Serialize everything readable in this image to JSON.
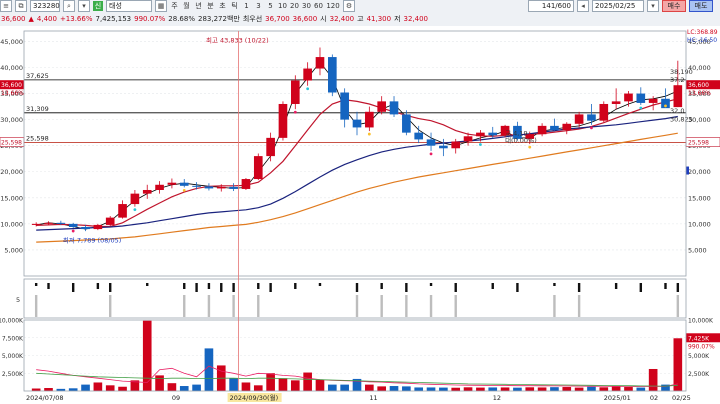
{
  "toolbar": {
    "code": "323280",
    "market_badge": "신",
    "name": "태성",
    "price": "36,600",
    "change": "4,400",
    "change_pct": "+13.66%",
    "volume": "7,425,153",
    "turnover_pct": "990.07%",
    "ratio": "28.68%",
    "trade_value": "283,272백만",
    "priority_label": "최우선",
    "bid": "36,700",
    "ask": "36,600",
    "open_label": "시",
    "open": "32,400",
    "high_label": "고",
    "high": "41,300",
    "low_label": "저",
    "low": "32,400",
    "periods": [
      "주",
      "월",
      "년",
      "분",
      "초",
      "틱"
    ],
    "minutes": [
      "1",
      "3",
      "5",
      "10",
      "20",
      "30",
      "60",
      "120"
    ],
    "count": "141/600",
    "date": "2025/02/25",
    "buy_label": "매수",
    "sell_label": "매도"
  },
  "chart_data": [
    {
      "type": "candlestick",
      "title": "",
      "y_ticks": [
        "45,000",
        "40,000",
        "35,000",
        "30,000",
        "25,000",
        "20,000",
        "15,000",
        "10,000",
        "5,000"
      ],
      "ylim": [
        0,
        47000
      ],
      "x_labels": [
        "2024/07/08",
        "09",
        "2024/09/30(월)",
        "11",
        "12",
        "2025/01",
        "02",
        "02/25"
      ],
      "hlines": [
        {
          "label": "37,625",
          "value": 37625,
          "color": "#000000"
        },
        {
          "label": "31,309",
          "value": 31309,
          "color": "#000000"
        },
        {
          "label": "25,598",
          "value": 25598,
          "color": "#c0392b"
        }
      ],
      "annotations": [
        {
          "text": "최고 43,833 (10/22)",
          "value": 43833
        },
        {
          "text": "최저 7,789 (08/05)",
          "value": 7789
        },
        {
          "text": "38,190",
          "value": 38190
        },
        {
          "text": "37.2",
          "value": 37200
        },
        {
          "text": "32.0",
          "value": 32000
        },
        {
          "text": "30,825",
          "value": 30825
        },
        {
          "text": "교 4,19",
          "value": 27000
        },
        {
          "text": "대(0.00%)",
          "value": 25600
        }
      ],
      "right_labels": {
        "lc": "LC:368.89",
        "hc": "HC:-16.50",
        "price": "36,600",
        "pct": "13.66%"
      },
      "left_labels": {
        "price": "36,600",
        "pct": "13.66%",
        "level": "25,598"
      },
      "series": [
        {
          "name": "ma5",
          "color": "#000000",
          "values": [
            9800,
            10200,
            10000,
            9500,
            9000,
            9500,
            10500,
            12500,
            14500,
            15800,
            16800,
            17500,
            17800,
            17500,
            17200,
            17000,
            16800,
            17000,
            20000,
            23000,
            28500,
            35000,
            38000,
            41000,
            38000,
            32000,
            29000,
            29500,
            32000,
            33000,
            30500,
            28000,
            26500,
            25500,
            25000,
            25800,
            26500,
            27000,
            27800,
            26500,
            26500,
            27800,
            28200,
            28500,
            28800,
            29500,
            30500,
            32000,
            33000,
            33800,
            34000,
            34500,
            35500
          ]
        },
        {
          "name": "ma20",
          "color": "#c0152d",
          "values": [
            9700,
            9800,
            9900,
            9850,
            9700,
            9500,
            9500,
            10200,
            11500,
            12800,
            14000,
            15200,
            16100,
            16800,
            17200,
            17300,
            17300,
            17400,
            18000,
            19800,
            22000,
            25000,
            28000,
            31000,
            33000,
            33800,
            33500,
            33000,
            32200,
            31500,
            30800,
            30200,
            29800,
            29000,
            27900,
            27200,
            26900,
            26800,
            27000,
            27100,
            27200,
            27300,
            27600,
            27900,
            28200,
            28700,
            29400,
            30300,
            31200,
            32000,
            32800,
            33400,
            34000
          ]
        },
        {
          "name": "ma60",
          "color": "#1a237e",
          "values": [
            8800,
            8900,
            9000,
            9100,
            9200,
            9300,
            9400,
            9600,
            9900,
            10200,
            10600,
            11000,
            11400,
            11800,
            12100,
            12300,
            12500,
            12700,
            13100,
            13800,
            14900,
            16200,
            17600,
            19000,
            20300,
            21400,
            22300,
            23100,
            23800,
            24300,
            24700,
            25000,
            25300,
            25500,
            25700,
            25900,
            26100,
            26400,
            26700,
            27000,
            27300,
            27600,
            27900,
            28200,
            28400,
            28600,
            28800,
            29000,
            29300,
            29600,
            29900,
            30200,
            30600
          ]
        },
        {
          "name": "ma120",
          "color": "#e07b1f",
          "values": [
            6500,
            6600,
            6700,
            6800,
            6900,
            7000,
            7100,
            7300,
            7500,
            7800,
            8100,
            8400,
            8700,
            9000,
            9300,
            9500,
            9700,
            9900,
            10300,
            10800,
            11400,
            12100,
            12900,
            13700,
            14500,
            15300,
            16100,
            16800,
            17400,
            18000,
            18500,
            19000,
            19400,
            19800,
            20200,
            20600,
            21000,
            21400,
            21800,
            22200,
            22600,
            23000,
            23400,
            23800,
            24200,
            24600,
            25000,
            25400,
            25800,
            26200,
            26600,
            27000,
            27400
          ]
        }
      ],
      "candles": [
        [
          9800,
          10300,
          9500,
          10000
        ],
        [
          10000,
          10500,
          9700,
          10200
        ],
        [
          10200,
          10600,
          9800,
          10000
        ],
        [
          10000,
          10200,
          9200,
          9400
        ],
        [
          9400,
          9800,
          8600,
          9000
        ],
        [
          9000,
          10000,
          8800,
          9800
        ],
        [
          9800,
          11500,
          9600,
          11200
        ],
        [
          11200,
          14500,
          11000,
          13800
        ],
        [
          13800,
          16500,
          13300,
          15800
        ],
        [
          15800,
          17500,
          14800,
          16500
        ],
        [
          16500,
          18200,
          15800,
          17500
        ],
        [
          17500,
          18700,
          16800,
          17900
        ],
        [
          17900,
          18600,
          17000,
          17300
        ],
        [
          17300,
          18000,
          16600,
          17200
        ],
        [
          17200,
          17800,
          16400,
          16800
        ],
        [
          16800,
          17600,
          16200,
          17100
        ],
        [
          17100,
          17800,
          16300,
          16700
        ],
        [
          16700,
          18800,
          16500,
          18600
        ],
        [
          18600,
          23500,
          18400,
          23000
        ],
        [
          23000,
          27500,
          22000,
          26500
        ],
        [
          26500,
          33500,
          26000,
          33000
        ],
        [
          33000,
          38500,
          32000,
          37500
        ],
        [
          37500,
          41000,
          36500,
          39800
        ],
        [
          39800,
          43833,
          38500,
          42000
        ],
        [
          42000,
          42500,
          34500,
          35200
        ],
        [
          35200,
          36000,
          28500,
          30000
        ],
        [
          30000,
          31500,
          27000,
          28500
        ],
        [
          28500,
          32500,
          27800,
          31500
        ],
        [
          31500,
          34500,
          31000,
          33500
        ],
        [
          33500,
          34500,
          30500,
          31000
        ],
        [
          31000,
          31800,
          27000,
          27500
        ],
        [
          27500,
          28800,
          25500,
          26200
        ],
        [
          26200,
          27500,
          24000,
          25000
        ],
        [
          25000,
          26300,
          23000,
          24500
        ],
        [
          24500,
          26300,
          23500,
          25800
        ],
        [
          25800,
          27500,
          25000,
          26800
        ],
        [
          26800,
          28000,
          25800,
          27500
        ],
        [
          27500,
          28600,
          26500,
          27000
        ],
        [
          27000,
          29000,
          26600,
          28800
        ],
        [
          28800,
          29600,
          26000,
          26300
        ],
        [
          26300,
          27700,
          25300,
          27200
        ],
        [
          27200,
          29300,
          26800,
          28800
        ],
        [
          28800,
          30200,
          27800,
          28000
        ],
        [
          28000,
          29500,
          27200,
          29200
        ],
        [
          29200,
          31500,
          28500,
          31000
        ],
        [
          31000,
          33000,
          29000,
          29800
        ],
        [
          29800,
          33500,
          29500,
          33000
        ],
        [
          33000,
          36000,
          32000,
          33500
        ],
        [
          33500,
          35500,
          32500,
          35000
        ],
        [
          35000,
          36200,
          32800,
          33200
        ],
        [
          33200,
          34500,
          31800,
          34000
        ],
        [
          34000,
          36000,
          33200,
          32200
        ],
        [
          32400,
          41300,
          32400,
          36600
        ]
      ],
      "dots": [
        {
          "label": "magenta",
          "color": "#e91e63"
        },
        {
          "label": "cyan",
          "color": "#26c6da"
        },
        {
          "label": "yellow",
          "color": "#fbc02d"
        }
      ]
    },
    {
      "type": "bar",
      "title": "",
      "y_ticks": [
        "5"
      ],
      "values": [
        -1,
        -2,
        0,
        -3,
        0,
        -2,
        -3,
        0,
        0,
        -1,
        0,
        0,
        -2,
        -3,
        -2,
        -3,
        -3,
        0,
        -2,
        -3,
        0,
        -2,
        0,
        -1,
        0,
        0,
        -3,
        0,
        -2,
        0,
        -3,
        0,
        -1,
        0,
        -3,
        0,
        0,
        -2,
        0,
        -3,
        0,
        0,
        -1,
        0,
        -3,
        0,
        0,
        -2,
        0,
        -3,
        0,
        -2,
        -3
      ]
    },
    {
      "type": "bar",
      "title": "",
      "y_ticks": [
        "10,000K",
        "7,500K",
        "5,000K",
        "2,500K"
      ],
      "ylim": [
        0,
        10000
      ],
      "values": [
        350,
        420,
        300,
        380,
        900,
        1200,
        800,
        600,
        1500,
        9900,
        2200,
        1100,
        700,
        900,
        6000,
        3600,
        1800,
        1200,
        800,
        2500,
        1800,
        1500,
        2600,
        1600,
        900,
        900,
        1700,
        900,
        650,
        700,
        650,
        500,
        500,
        480,
        460,
        520,
        480,
        500,
        500,
        470,
        520,
        500,
        540,
        560,
        480,
        600,
        520,
        620,
        560,
        480,
        3100,
        900,
        7425
      ],
      "labels": {
        "vol": "7,425K",
        "pct": "990.07%"
      },
      "ma_series": [
        {
          "name": "vma5",
          "color": "#e91e63",
          "values": [
            3000,
            2800,
            2500,
            2200,
            2000,
            1800,
            1600,
            1400,
            1300,
            1200,
            3000,
            3200,
            2500,
            2000,
            3500,
            2800,
            2500,
            2100,
            2500,
            2400,
            2200,
            2100,
            1800,
            1600,
            1500,
            1450,
            1400,
            1300,
            1250,
            1150,
            1100,
            1000,
            950,
            900,
            850,
            820,
            800,
            780,
            770,
            750,
            740,
            730,
            720,
            700,
            690,
            680,
            670,
            660,
            650,
            640,
            640,
            650,
            1000
          ]
        },
        {
          "name": "vma20",
          "color": "#43a047",
          "values": [
            2500,
            2400,
            2300,
            2200,
            2100,
            2000,
            1950,
            1900,
            1850,
            1800,
            1750,
            1800,
            1800,
            1750,
            1750,
            1800,
            1800,
            1750,
            1800,
            1800,
            1750,
            1700,
            1650,
            1600,
            1550,
            1500,
            1450,
            1400,
            1350,
            1300,
            1250,
            1200,
            1150,
            1100,
            1050,
            1000,
            980,
            960,
            940,
            920,
            900,
            880,
            860,
            840,
            820,
            800,
            780,
            760,
            740,
            720,
            700,
            690,
            800
          ]
        }
      ]
    }
  ]
}
